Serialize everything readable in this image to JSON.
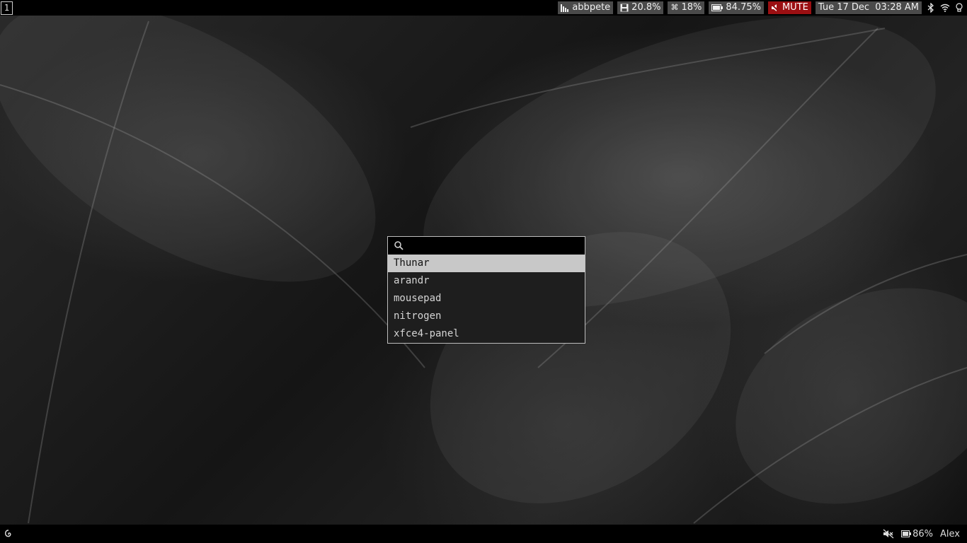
{
  "top_bar": {
    "workspace": "1",
    "status": [
      {
        "id": "network",
        "icon": "signal-bars-icon",
        "text": "abbpete"
      },
      {
        "id": "disk",
        "icon": "floppy-disk-icon",
        "text": "20.8%"
      },
      {
        "id": "cpu",
        "icon": "command-key-icon",
        "text": "18%"
      },
      {
        "id": "battery",
        "icon": "battery-icon",
        "text": "84.75%"
      },
      {
        "id": "volume",
        "icon": "speaker-muted-icon",
        "text": "MUTE"
      },
      {
        "id": "clock",
        "icon": "",
        "text": "Tue 17 Dec  03:28 AM"
      }
    ],
    "tray_icons": [
      "bluetooth-icon",
      "wifi-icon",
      "lightbulb-icon"
    ],
    "colors": {
      "mute_bg": "#9b0f12",
      "block_bg": "#4a4a4a"
    }
  },
  "launcher": {
    "search_placeholder": "",
    "search_value": "",
    "entries": [
      "Thunar",
      "arandr",
      "mousepad",
      "nitrogen",
      "xfce4-panel"
    ],
    "selected_index": 0
  },
  "bottom_bar": {
    "battery_percent": "86%",
    "user": "Alex"
  }
}
